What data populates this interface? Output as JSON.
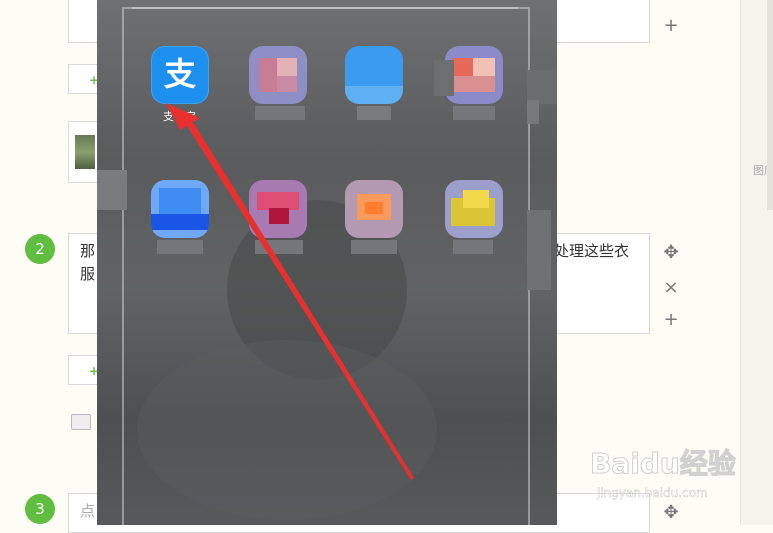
{
  "editor": {
    "add_label": "+",
    "step2": {
      "number": "2",
      "text_start": "那",
      "text_start_line2": "服",
      "text_end": "处理这些衣"
    },
    "step3": {
      "number": "3",
      "placeholder_start": "点"
    },
    "controls": {
      "plus": "+",
      "close": "×",
      "move": "✥"
    }
  },
  "right_panel": {
    "label": "图库"
  },
  "phone": {
    "apps": [
      {
        "name": "alipay",
        "glyph": "支",
        "label": "支付宝",
        "color": "#1d8fee"
      }
    ]
  },
  "watermark": {
    "brand": "Baidu经验",
    "url": "jingyan.baidu.com"
  },
  "colors": {
    "step_badge": "#5fbe3f",
    "arrow": "#e8312f",
    "background": "#fdfdf5"
  }
}
